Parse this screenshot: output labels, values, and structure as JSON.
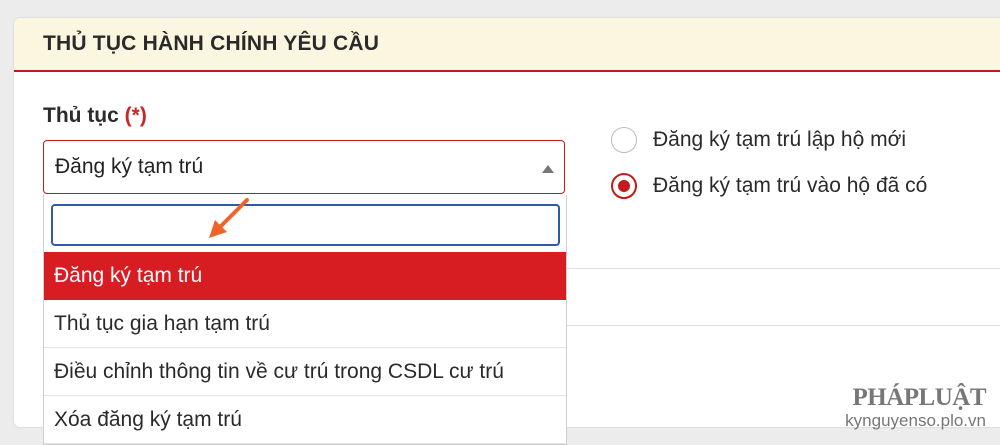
{
  "panel": {
    "title": "THỦ TỤC HÀNH CHÍNH YÊU CẦU"
  },
  "procedure": {
    "label": "Thủ tục",
    "required_mark": "(*)",
    "selected_value": "Đăng ký tạm trú",
    "search_value": "",
    "options": [
      "Đăng ký tạm trú",
      "Thủ tục gia hạn tạm trú",
      "Điều chỉnh thông tin về cư trú trong CSDL cư trú",
      "Xóa đăng ký tạm trú"
    ],
    "selected_index": 0
  },
  "radio": {
    "options": [
      {
        "label": "Đăng ký tạm trú lập hộ mới",
        "checked": false
      },
      {
        "label": "Đăng ký tạm trú vào hộ đã có",
        "checked": true
      }
    ]
  },
  "watermark": {
    "brand": "PHÁPLUẬT",
    "url": "kynguyenso.plo.vn"
  },
  "colors": {
    "accent": "#c21b1b",
    "header_bg": "#fbf6df",
    "selected_bg": "#d71c22",
    "focus": "#2e5aa8"
  }
}
